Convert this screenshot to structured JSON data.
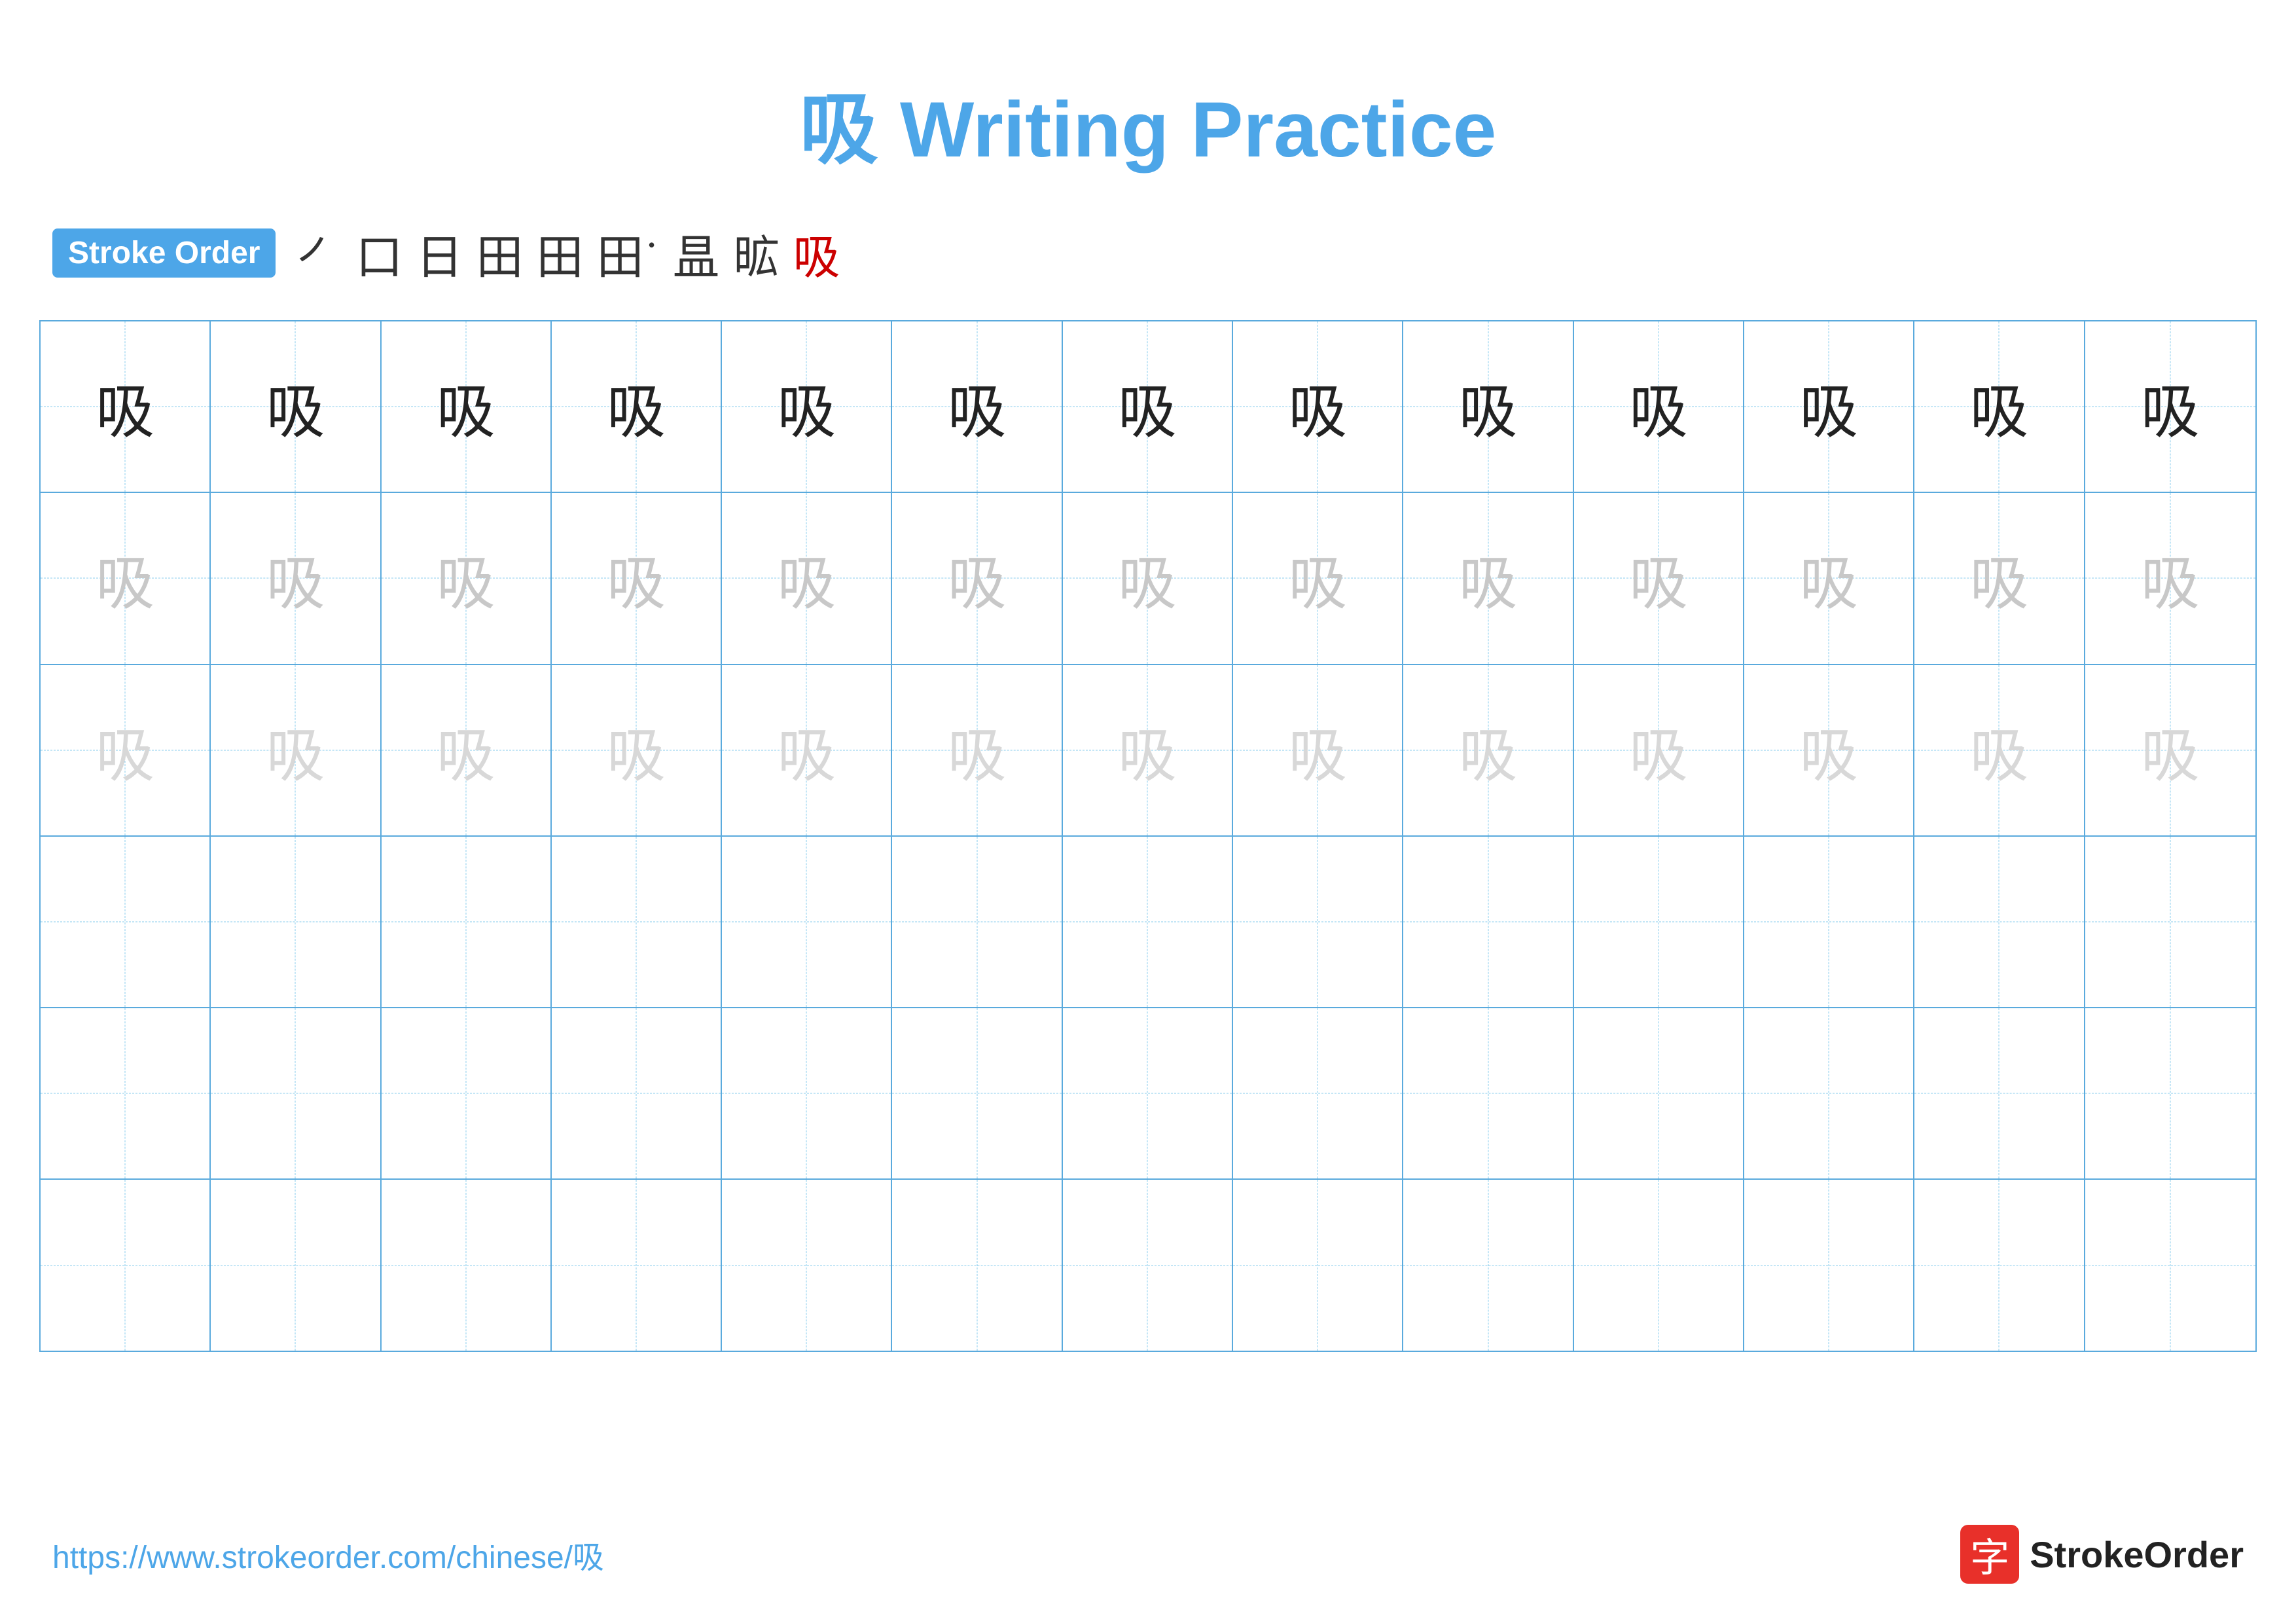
{
  "title": {
    "text": "吸 Writing Practice",
    "color": "#4da6e8"
  },
  "stroke_order": {
    "badge_label": "Stroke Order",
    "strokes": [
      {
        "char": "㇒",
        "red": false
      },
      {
        "char": "口",
        "red": false
      },
      {
        "char": "日",
        "red": false
      },
      {
        "char": "田",
        "red": false
      },
      {
        "char": "田",
        "red": false
      },
      {
        "char": "田˙",
        "red": false
      },
      {
        "char": "畀",
        "red": false
      },
      {
        "char": "昿",
        "red": false
      },
      {
        "char": "吸",
        "red": true
      }
    ]
  },
  "grid": {
    "rows": 6,
    "cols": 13,
    "character": "吸",
    "row_styles": [
      "dark",
      "light1",
      "light2",
      "empty",
      "empty",
      "empty"
    ]
  },
  "footer": {
    "url": "https://www.strokeorder.com/chinese/吸",
    "logo_text": "StrokeOrder"
  }
}
